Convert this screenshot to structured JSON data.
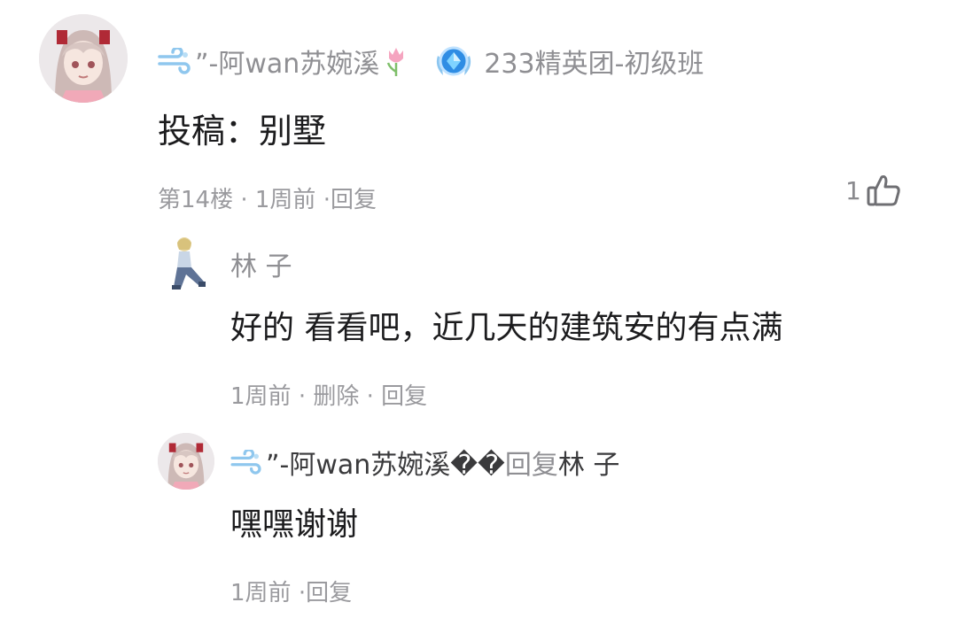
{
  "comment": {
    "username": "”-阿wan苏婉溪",
    "username_suffix_icon": "tulip-emoji",
    "badge_icon": "blue-crystal-badge",
    "fan_club": "233精英团-初级班",
    "body": "投稿：别墅",
    "floor": "第14楼",
    "sep1": "·",
    "time": "1周前",
    "sep2": "·",
    "reply_label": "回复",
    "like_count": "1",
    "like_icon": "thumbs-up-icon"
  },
  "replies": [
    {
      "username": "林 子",
      "body": "好的 看看吧，近几天的建筑安的有点满",
      "time": "1周前",
      "sep1": "·",
      "delete_label": "删除",
      "sep2": "·",
      "reply_label": "回复"
    },
    {
      "username": "”-阿wan苏婉溪��",
      "reply_word": "回复",
      "reply_target": "林 子",
      "body": "嘿嘿谢谢",
      "time": "1周前",
      "sep": "·",
      "reply_label": "回复"
    }
  ],
  "colors": {
    "meta_gray": "#9a9a9e",
    "name_gray": "#8f8f93",
    "text": "#1c1c1e",
    "badge_blue": "#2f8de4"
  }
}
